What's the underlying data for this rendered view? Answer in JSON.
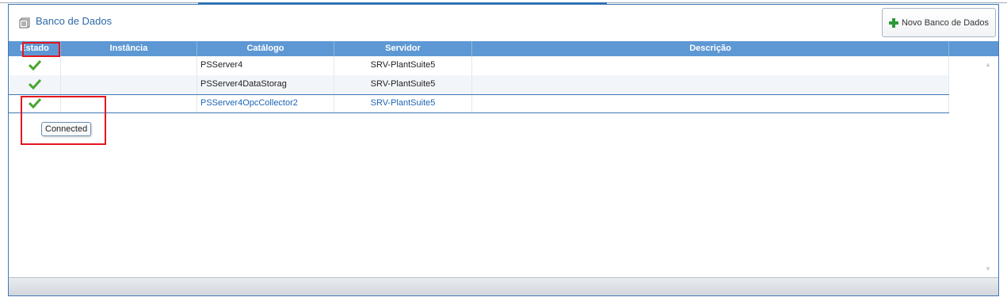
{
  "panel": {
    "title": "Banco de Dados",
    "new_button_label": "Novo Banco de Dados",
    "icons": {
      "header": "database-icon",
      "new": "plus-icon",
      "status": "check-icon"
    }
  },
  "grid": {
    "columns": [
      "Estado",
      "Instância",
      "Catálogo",
      "Servidor",
      "Descrição"
    ],
    "rows": [
      {
        "estado": "ok",
        "instancia": "",
        "catalogo": "PSServer4",
        "servidor": "SRV-PlantSuite5",
        "descricao": ""
      },
      {
        "estado": "ok",
        "instancia": "",
        "catalogo": "PSServer4DataStorag",
        "servidor": "SRV-PlantSuite5",
        "descricao": ""
      },
      {
        "estado": "ok",
        "instancia": "",
        "catalogo": "PSServer4OpcCollector2",
        "servidor": "SRV-PlantSuite5",
        "descricao": ""
      }
    ]
  },
  "tooltip": {
    "text": "Connected"
  },
  "colors": {
    "accent": "#5e98d4",
    "selected_text": "#1e64b4",
    "annotation": "#e3171f",
    "status_ok": "#4aa52e"
  }
}
